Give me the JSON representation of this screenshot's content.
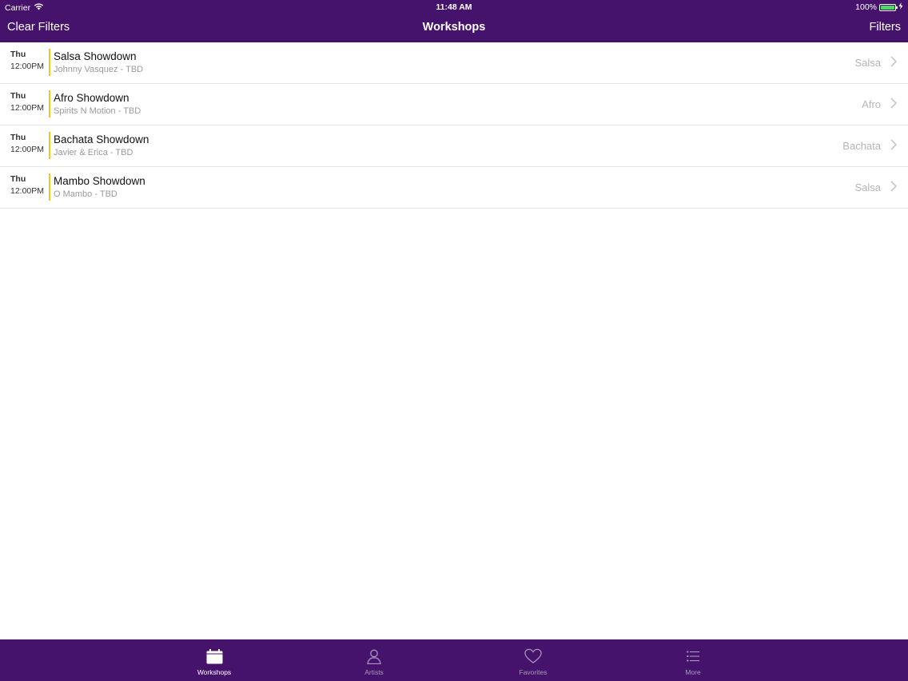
{
  "status_bar": {
    "carrier": "Carrier",
    "time": "11:48 AM",
    "battery": "100%",
    "battery_level": 1.0
  },
  "nav": {
    "left_button": "Clear Filters",
    "title": "Workshops",
    "right_button": "Filters"
  },
  "workshops": [
    {
      "day": "Thu",
      "time": "12:00PM",
      "title": "Salsa Showdown",
      "subtitle": "Johnny Vasquez - TBD",
      "category": "Salsa"
    },
    {
      "day": "Thu",
      "time": "12:00PM",
      "title": "Afro Showdown",
      "subtitle": "Spirits N Motion - TBD",
      "category": "Afro"
    },
    {
      "day": "Thu",
      "time": "12:00PM",
      "title": "Bachata Showdown",
      "subtitle": "Javier & Erica - TBD",
      "category": "Bachata"
    },
    {
      "day": "Thu",
      "time": "12:00PM",
      "title": "Mambo Showdown",
      "subtitle": "O Mambo - TBD",
      "category": "Salsa"
    }
  ],
  "tabbar": {
    "tabs": [
      {
        "label": "Workshops",
        "icon": "calendar-icon",
        "active": true
      },
      {
        "label": "Artists",
        "icon": "person-icon",
        "active": false
      },
      {
        "label": "Favorites",
        "icon": "heart-icon",
        "active": false
      },
      {
        "label": "More",
        "icon": "list-icon",
        "active": false
      }
    ]
  },
  "colors": {
    "brand_purple": "#46136c",
    "accent_yellow": "#f5c518",
    "battery_green": "#4cd964"
  }
}
